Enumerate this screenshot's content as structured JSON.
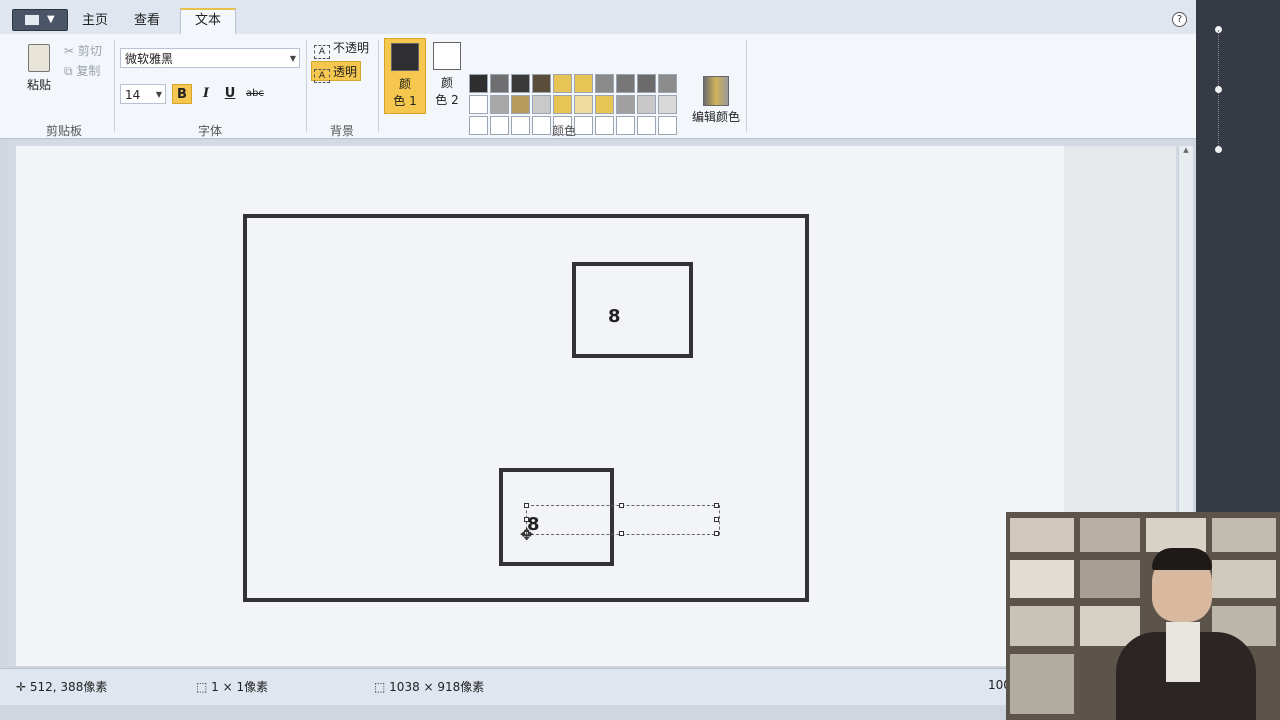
{
  "tabs": [
    {
      "label": "主页"
    },
    {
      "label": "查看"
    },
    {
      "label": "文本"
    }
  ],
  "active_tab": "文本",
  "clipboard": {
    "paste_label": "粘贴",
    "cut_label": "剪切",
    "copy_label": "复制",
    "group_label": "剪贴板"
  },
  "font": {
    "family_value": "微软雅黑",
    "size_value": "14",
    "bold_label": "B",
    "italic_label": "I",
    "underline_label": "U",
    "strike_label": "abc",
    "group_label": "字体"
  },
  "background": {
    "opaque_label": "不透明",
    "transparent_label": "透明",
    "group_label": "背景"
  },
  "colors": {
    "color1_label_a": "颜",
    "color1_label_b": "色 1",
    "color2_label_a": "颜",
    "color2_label_b": "色 2",
    "edit_label": "编辑颜色",
    "group_label": "颜色",
    "color1": "#2f2f33",
    "color2": "#ffffff",
    "palette": [
      "#2e2e2e",
      "#6f6f72",
      "#3a3a3a",
      "#5a4e3a",
      "#e8c456",
      "#e8c456",
      "#8a8a8a",
      "#777777",
      "#6b6b6b",
      "#8c8c8c",
      "#ffffff",
      "#a8a8a8",
      "#b69c5c",
      "#c9c9c9",
      "#e8c456",
      "#f0dca0",
      "#e8c456",
      "#a0a0a0",
      "#c8c8c8",
      "#d9d9d9",
      "#ffffff",
      "#ffffff",
      "#ffffff",
      "#ffffff",
      "#ffffff",
      "#ffffff",
      "#ffffff",
      "#ffffff",
      "#ffffff",
      "#ffffff"
    ]
  },
  "canvas": {
    "top_box_digit": "8",
    "bottom_box_digit": "8"
  },
  "status": {
    "cursor_pos": "512, 388像素",
    "selection_size": "1 × 1像素",
    "image_size": "1038 × 918像素",
    "zoom": "100"
  }
}
